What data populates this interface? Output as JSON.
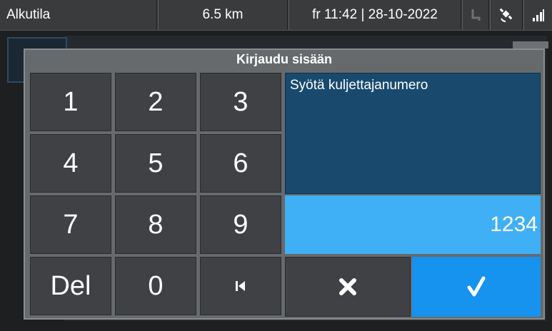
{
  "statusbar": {
    "title": "Alkutila",
    "distance": "6.5 km",
    "datetime": "fr 11:42 | 28-10-2022",
    "icons": [
      "seat-icon",
      "satellite-icon",
      "signal-icon"
    ]
  },
  "dialog": {
    "title": "Kirjaudu sisään",
    "prompt": "Syötä kuljettajanumero",
    "value": "1234",
    "keys": {
      "k1": "1",
      "k2": "2",
      "k3": "3",
      "k4": "4",
      "k5": "5",
      "k6": "6",
      "k7": "7",
      "k8": "8",
      "k9": "9",
      "del": "Del",
      "k0": "0"
    },
    "icons": {
      "first": "skip-to-start-icon",
      "cancel": "close-icon",
      "ok": "checkmark-icon"
    },
    "colors": {
      "accent": "#1593ee",
      "field": "#3fb0f6",
      "prompt_bg": "#194a6e"
    }
  }
}
